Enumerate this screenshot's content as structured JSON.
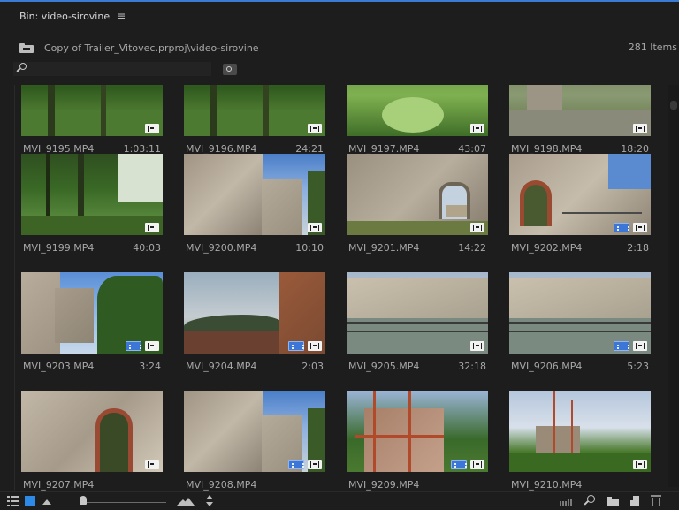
{
  "panel": {
    "title": "Bin: video-sirovine",
    "menu_glyph": "≡",
    "path": "Copy of Trailer_Vitovec.prproj\\video-sirovine",
    "item_count": "281 Items",
    "search": {
      "value": "",
      "placeholder": ""
    }
  },
  "clips": [
    {
      "name": "MVI_9195.MP4",
      "duration": "1:03:11",
      "scene": "forest-top",
      "badge": "video"
    },
    {
      "name": "MVI_9196.MP4",
      "duration": "24:21",
      "scene": "forest-top",
      "badge": "video"
    },
    {
      "name": "MVI_9197.MP4",
      "duration": "43:07",
      "scene": "leaves-top",
      "badge": "video"
    },
    {
      "name": "MVI_9198.MP4",
      "duration": "18:20",
      "scene": "ruin-top",
      "badge": "video"
    },
    {
      "name": "MVI_9199.MP4",
      "duration": "40:03",
      "scene": "forest",
      "badge": "video"
    },
    {
      "name": "MVI_9200.MP4",
      "duration": "10:10",
      "scene": "wall-sky",
      "badge": "video"
    },
    {
      "name": "MVI_9201.MP4",
      "duration": "14:22",
      "scene": "wall-window",
      "badge": "video"
    },
    {
      "name": "MVI_9202.MP4",
      "duration": "2:18",
      "scene": "arch-wall",
      "badge": "video+audio"
    },
    {
      "name": "MVI_9203.MP4",
      "duration": "3:24",
      "scene": "wall-trees",
      "badge": "video+audio"
    },
    {
      "name": "MVI_9204.MP4",
      "duration": "2:03",
      "scene": "landscape",
      "badge": "video+audio"
    },
    {
      "name": "MVI_9205.MP4",
      "duration": "32:18",
      "scene": "wall-rail",
      "badge": "video"
    },
    {
      "name": "MVI_9206.MP4",
      "duration": "5:23",
      "scene": "wall-rail",
      "badge": "video+audio"
    },
    {
      "name": "MVI_9207.MP4",
      "duration": "",
      "scene": "arch-window",
      "badge": "video"
    },
    {
      "name": "MVI_9208.MP4",
      "duration": "",
      "scene": "wall-sky",
      "badge": "video+audio"
    },
    {
      "name": "MVI_9209.MP4",
      "duration": "",
      "scene": "scaffold",
      "badge": "video+audio"
    },
    {
      "name": "MVI_9210.MP4",
      "duration": "",
      "scene": "scaffold-sky",
      "badge": "video"
    }
  ],
  "colors": {
    "accent": "#3a7bd5",
    "icon_view_active": "#2c8ae6",
    "audio_badge": "#3c77d8",
    "background": "#1d1d1d"
  },
  "footer": {
    "zoom_level": 0.0,
    "icons": [
      "list-view-icon",
      "icon-view-icon",
      "freeform-view-icon",
      "zoom-slider",
      "sort-icons-icon",
      "automate-to-sequence-icon",
      "find-icon",
      "new-bin-icon",
      "new-item-icon",
      "clear-icon"
    ]
  }
}
